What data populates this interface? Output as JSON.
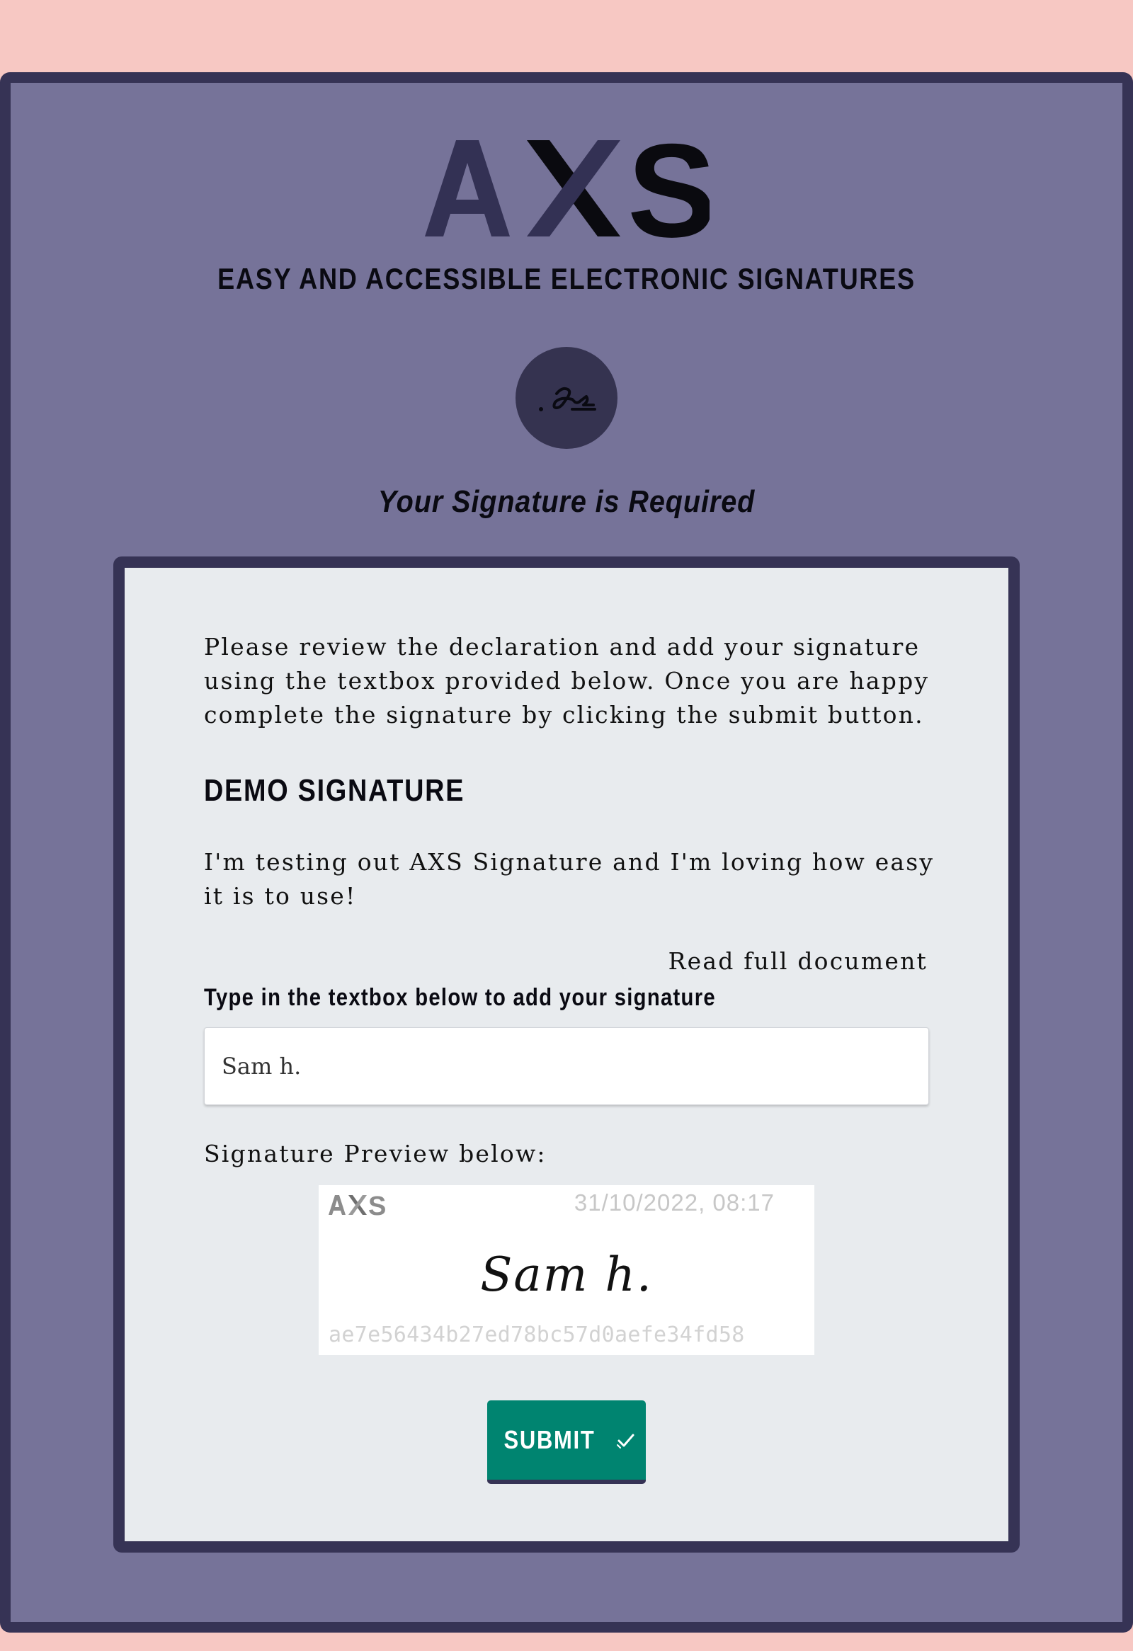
{
  "brand": {
    "logo_text": "AXS",
    "tagline": "EASY AND ACCESSIBLE ELECTRONIC SIGNATURES"
  },
  "header": {
    "signature_icon": "signature-icon",
    "required_text": "Your Signature is Required"
  },
  "card": {
    "intro": "Please review the declaration and add your signature using the textbox provided below. Once you are happy complete the signature by clicking the submit button.",
    "document_title": "DEMO SIGNATURE",
    "document_body": "I'm testing out AXS Signature and I'm loving how easy it is to use!",
    "read_full_link": "Read full document",
    "input_label": "Type in the textbox below to add your signature",
    "input_value": "Sam h.",
    "preview_label": "Signature Preview below:",
    "preview": {
      "logo_text": "AXS",
      "timestamp": "31/10/2022, 08:17",
      "signature_text": "Sam h.",
      "hash": "ae7e56434b27ed78bc57d0aefe34fd58"
    },
    "submit_label": "SUBMIT",
    "submit_icon": "check-icon"
  },
  "colors": {
    "page_background": "#f7c8c3",
    "frame_background": "#767399",
    "frame_border": "#363355",
    "card_background": "#e8ebee",
    "submit_background": "#008470"
  }
}
